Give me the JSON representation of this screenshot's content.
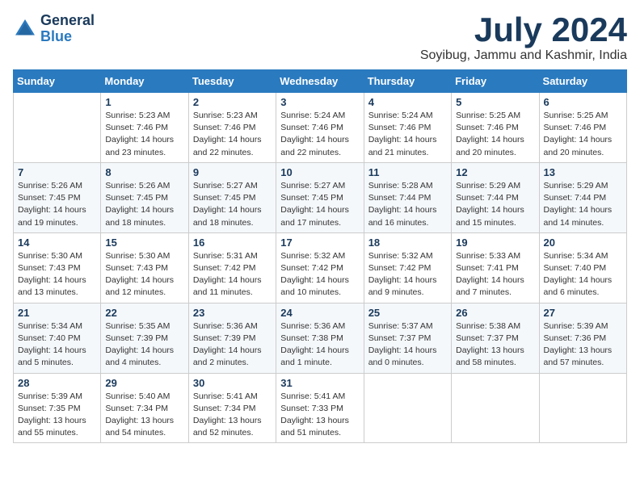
{
  "logo": {
    "text_general": "General",
    "text_blue": "Blue"
  },
  "title": {
    "month": "July 2024",
    "location": "Soyibug, Jammu and Kashmir, India"
  },
  "days_of_week": [
    "Sunday",
    "Monday",
    "Tuesday",
    "Wednesday",
    "Thursday",
    "Friday",
    "Saturday"
  ],
  "weeks": [
    [
      {
        "day": "",
        "info": ""
      },
      {
        "day": "1",
        "info": "Sunrise: 5:23 AM\nSunset: 7:46 PM\nDaylight: 14 hours\nand 23 minutes."
      },
      {
        "day": "2",
        "info": "Sunrise: 5:23 AM\nSunset: 7:46 PM\nDaylight: 14 hours\nand 22 minutes."
      },
      {
        "day": "3",
        "info": "Sunrise: 5:24 AM\nSunset: 7:46 PM\nDaylight: 14 hours\nand 22 minutes."
      },
      {
        "day": "4",
        "info": "Sunrise: 5:24 AM\nSunset: 7:46 PM\nDaylight: 14 hours\nand 21 minutes."
      },
      {
        "day": "5",
        "info": "Sunrise: 5:25 AM\nSunset: 7:46 PM\nDaylight: 14 hours\nand 20 minutes."
      },
      {
        "day": "6",
        "info": "Sunrise: 5:25 AM\nSunset: 7:46 PM\nDaylight: 14 hours\nand 20 minutes."
      }
    ],
    [
      {
        "day": "7",
        "info": "Sunrise: 5:26 AM\nSunset: 7:45 PM\nDaylight: 14 hours\nand 19 minutes."
      },
      {
        "day": "8",
        "info": "Sunrise: 5:26 AM\nSunset: 7:45 PM\nDaylight: 14 hours\nand 18 minutes."
      },
      {
        "day": "9",
        "info": "Sunrise: 5:27 AM\nSunset: 7:45 PM\nDaylight: 14 hours\nand 18 minutes."
      },
      {
        "day": "10",
        "info": "Sunrise: 5:27 AM\nSunset: 7:45 PM\nDaylight: 14 hours\nand 17 minutes."
      },
      {
        "day": "11",
        "info": "Sunrise: 5:28 AM\nSunset: 7:44 PM\nDaylight: 14 hours\nand 16 minutes."
      },
      {
        "day": "12",
        "info": "Sunrise: 5:29 AM\nSunset: 7:44 PM\nDaylight: 14 hours\nand 15 minutes."
      },
      {
        "day": "13",
        "info": "Sunrise: 5:29 AM\nSunset: 7:44 PM\nDaylight: 14 hours\nand 14 minutes."
      }
    ],
    [
      {
        "day": "14",
        "info": "Sunrise: 5:30 AM\nSunset: 7:43 PM\nDaylight: 14 hours\nand 13 minutes."
      },
      {
        "day": "15",
        "info": "Sunrise: 5:30 AM\nSunset: 7:43 PM\nDaylight: 14 hours\nand 12 minutes."
      },
      {
        "day": "16",
        "info": "Sunrise: 5:31 AM\nSunset: 7:42 PM\nDaylight: 14 hours\nand 11 minutes."
      },
      {
        "day": "17",
        "info": "Sunrise: 5:32 AM\nSunset: 7:42 PM\nDaylight: 14 hours\nand 10 minutes."
      },
      {
        "day": "18",
        "info": "Sunrise: 5:32 AM\nSunset: 7:42 PM\nDaylight: 14 hours\nand 9 minutes."
      },
      {
        "day": "19",
        "info": "Sunrise: 5:33 AM\nSunset: 7:41 PM\nDaylight: 14 hours\nand 7 minutes."
      },
      {
        "day": "20",
        "info": "Sunrise: 5:34 AM\nSunset: 7:40 PM\nDaylight: 14 hours\nand 6 minutes."
      }
    ],
    [
      {
        "day": "21",
        "info": "Sunrise: 5:34 AM\nSunset: 7:40 PM\nDaylight: 14 hours\nand 5 minutes."
      },
      {
        "day": "22",
        "info": "Sunrise: 5:35 AM\nSunset: 7:39 PM\nDaylight: 14 hours\nand 4 minutes."
      },
      {
        "day": "23",
        "info": "Sunrise: 5:36 AM\nSunset: 7:39 PM\nDaylight: 14 hours\nand 2 minutes."
      },
      {
        "day": "24",
        "info": "Sunrise: 5:36 AM\nSunset: 7:38 PM\nDaylight: 14 hours\nand 1 minute."
      },
      {
        "day": "25",
        "info": "Sunrise: 5:37 AM\nSunset: 7:37 PM\nDaylight: 14 hours\nand 0 minutes."
      },
      {
        "day": "26",
        "info": "Sunrise: 5:38 AM\nSunset: 7:37 PM\nDaylight: 13 hours\nand 58 minutes."
      },
      {
        "day": "27",
        "info": "Sunrise: 5:39 AM\nSunset: 7:36 PM\nDaylight: 13 hours\nand 57 minutes."
      }
    ],
    [
      {
        "day": "28",
        "info": "Sunrise: 5:39 AM\nSunset: 7:35 PM\nDaylight: 13 hours\nand 55 minutes."
      },
      {
        "day": "29",
        "info": "Sunrise: 5:40 AM\nSunset: 7:34 PM\nDaylight: 13 hours\nand 54 minutes."
      },
      {
        "day": "30",
        "info": "Sunrise: 5:41 AM\nSunset: 7:34 PM\nDaylight: 13 hours\nand 52 minutes."
      },
      {
        "day": "31",
        "info": "Sunrise: 5:41 AM\nSunset: 7:33 PM\nDaylight: 13 hours\nand 51 minutes."
      },
      {
        "day": "",
        "info": ""
      },
      {
        "day": "",
        "info": ""
      },
      {
        "day": "",
        "info": ""
      }
    ]
  ]
}
